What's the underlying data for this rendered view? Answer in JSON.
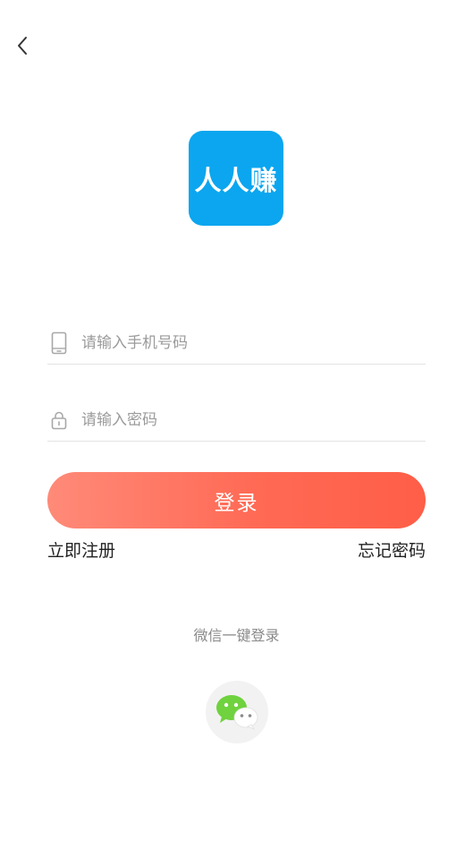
{
  "header": {
    "back_icon": "chevron-left-icon"
  },
  "logo": {
    "text": "人人赚",
    "color": "#0ba6ef"
  },
  "form": {
    "phone": {
      "placeholder": "请输入手机号码",
      "value": "",
      "icon": "phone-icon"
    },
    "password": {
      "placeholder": "请输入密码",
      "value": "",
      "icon": "lock-icon"
    },
    "login_label": "登录",
    "login_colors": [
      "#ff8a78",
      "#ff5e47"
    ]
  },
  "links": {
    "register": "立即注册",
    "forgot": "忘记密码"
  },
  "wechat": {
    "label": "微信一键登录",
    "icon": "wechat-icon",
    "color": "#6fd23e"
  }
}
